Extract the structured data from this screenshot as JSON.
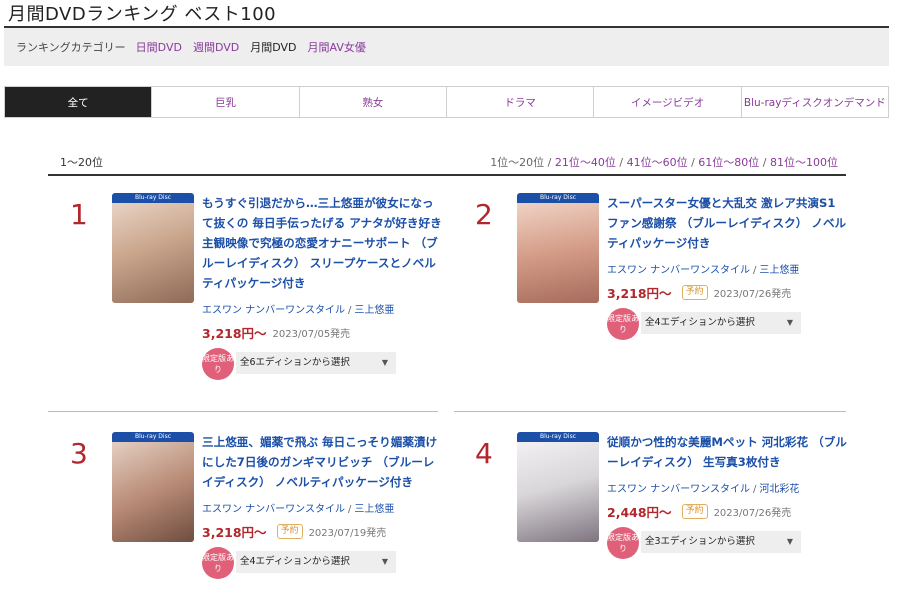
{
  "page": {
    "title": "月間DVDランキング ベスト100"
  },
  "category_bar": {
    "label": "ランキングカテゴリー",
    "links": [
      {
        "label": "日間DVD",
        "active": false
      },
      {
        "label": "週間DVD",
        "active": false
      },
      {
        "label": "月間DVD",
        "active": true
      },
      {
        "label": "月間AV女優",
        "active": false
      }
    ]
  },
  "tabs": [
    {
      "label": "全て",
      "active": true
    },
    {
      "label": "巨乳",
      "active": false
    },
    {
      "label": "熟女",
      "active": false
    },
    {
      "label": "ドラマ",
      "active": false
    },
    {
      "label": "イメージビデオ",
      "active": false
    },
    {
      "label": "Blu-rayディスクオンデマンド",
      "active": false
    }
  ],
  "range": {
    "current": "1〜20位",
    "pages": [
      "1位〜20位",
      "21位〜40位",
      "41位〜60位",
      "61位〜80位",
      "81位〜100位"
    ],
    "separator": " / "
  },
  "items": [
    {
      "rank": "1",
      "title": "もうすぐ引退だから…三上悠亜が彼女になって抜くの 毎日手伝ったげる アナタが好き好き主観映像で究極の恋愛オナニーサポート （ブルーレイディスク） スリープケースとノベルティパッケージ付き",
      "maker": "エスワン ナンバーワンスタイル",
      "actress": "三上悠亜",
      "price": "3,218円〜",
      "reserve": "",
      "date": "2023/07/05発売",
      "limited": "限定版あり",
      "edition": "全6エディションから選択",
      "cover_color": "#c9a58c"
    },
    {
      "rank": "2",
      "title": "スーパースター女優と大乱交 激レア共演S1ファン感謝祭 （ブルーレイディスク） ノベルティパッケージ付き",
      "maker": "エスワン ナンバーワンスタイル",
      "actress": "三上悠亜",
      "price": "3,218円〜",
      "reserve": "予約",
      "date": "2023/07/26発売",
      "limited": "限定版あり",
      "edition": "全4エディションから選択",
      "cover_color": "#d39b86"
    },
    {
      "rank": "3",
      "title": "三上悠亜、媚薬で飛ぶ 毎日こっそり媚薬漬けにした7日後のガンギマリビッチ （ブルーレイディスク） ノベルティパッケージ付き",
      "maker": "エスワン ナンバーワンスタイル",
      "actress": "三上悠亜",
      "price": "3,218円〜",
      "reserve": "予約",
      "date": "2023/07/19発売",
      "limited": "限定版あり",
      "edition": "全4エディションから選択",
      "cover_color": "#b98c77"
    },
    {
      "rank": "4",
      "title": "従順かつ性的な美麗Mペット 河北彩花 （ブルーレイディスク） 生写真3枚付き",
      "maker": "エスワン ナンバーワンスタイル",
      "actress": "河北彩花",
      "price": "2,448円〜",
      "reserve": "予約",
      "date": "2023/07/26発売",
      "limited": "限定版あり",
      "edition": "全3エディションから選択",
      "cover_color": "#d8d6d8"
    }
  ],
  "labels": {
    "bluray_band": "Blu-ray Disc",
    "dropdown_arrow": "▼",
    "maker_sep": "/"
  },
  "colors": {
    "accent": "#8a3a9a",
    "rank": "#b3262c",
    "link": "#1b4fa8",
    "limited_badge": "#e0607a"
  }
}
